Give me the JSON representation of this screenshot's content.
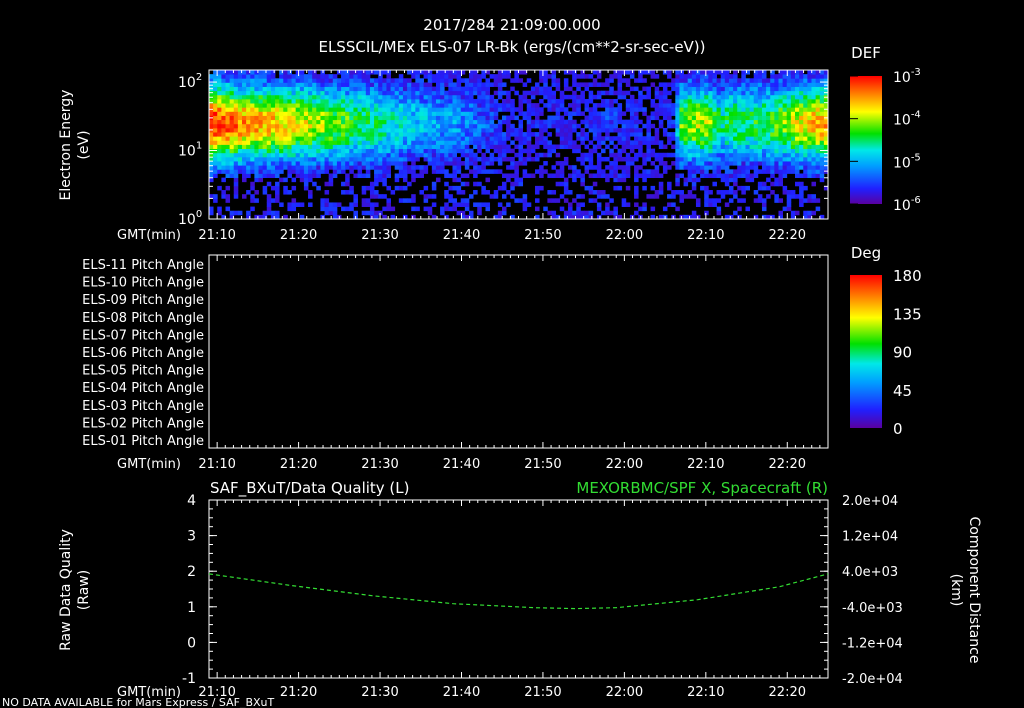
{
  "header": {
    "title": "2017/284 21:09:00.000",
    "subtitle": "ELSSCIL/MEx ELS-07 LR-Bk  (ergs/(cm**2-sr-sec-eV))"
  },
  "time_axis": {
    "label": "GMT(min)",
    "ticks": [
      "21:10",
      "21:20",
      "21:30",
      "21:40",
      "21:50",
      "22:00",
      "22:10",
      "22:20"
    ]
  },
  "footer_note": "NO DATA AVAILABLE for Mars  Express / SAF_BXuT",
  "chart_data": [
    {
      "type": "heatmap",
      "ylabel_line1": "Electron Energy",
      "ylabel_line2": "(eV)",
      "y_scale": "log",
      "ylim": [
        1,
        150
      ],
      "y_ticks": [
        {
          "base": "10",
          "exp": "0",
          "value": 1
        },
        {
          "base": "10",
          "exp": "1",
          "value": 10
        },
        {
          "base": "10",
          "exp": "2",
          "value": 100
        }
      ],
      "x_range_min": [
        0,
        76
      ],
      "time_ticks_min": [
        1,
        11,
        21,
        31,
        41,
        51,
        61,
        71
      ],
      "colorbar": {
        "title": "DEF",
        "scale": "log",
        "range": [
          1e-06,
          0.001
        ],
        "ticks": [
          {
            "base": "10",
            "exp": "-3",
            "value": 0.001
          },
          {
            "base": "10",
            "exp": "-4",
            "value": 0.0001
          },
          {
            "base": "10",
            "exp": "-5",
            "value": 1e-05
          },
          {
            "base": "10",
            "exp": "-6",
            "value": 1e-06
          }
        ]
      },
      "activity_by_time": [
        [
          0,
          1.0
        ],
        [
          4,
          0.85
        ],
        [
          10,
          0.75
        ],
        [
          18,
          0.55
        ],
        [
          24,
          0.4
        ],
        [
          28,
          0.3
        ],
        [
          30,
          0.3
        ],
        [
          33,
          0.22
        ],
        [
          36,
          0.12
        ],
        [
          40,
          0.08
        ],
        [
          48,
          0.08
        ],
        [
          49,
          0.15
        ],
        [
          52,
          0.08
        ],
        [
          57,
          0.1
        ],
        [
          58,
          0.6
        ],
        [
          61,
          0.7
        ],
        [
          63,
          0.45
        ],
        [
          64,
          0.55
        ],
        [
          66,
          0.5
        ],
        [
          70,
          0.6
        ],
        [
          73,
          0.75
        ],
        [
          76,
          0.85
        ]
      ],
      "peak_energy_ev": 25,
      "grid": false
    },
    {
      "type": "heatmap",
      "rows": [
        "ELS-11 Pitch Angle",
        "ELS-10 Pitch Angle",
        "ELS-09 Pitch Angle",
        "ELS-08 Pitch Angle",
        "ELS-07 Pitch Angle",
        "ELS-06 Pitch Angle",
        "ELS-05 Pitch Angle",
        "ELS-04 Pitch Angle",
        "ELS-03 Pitch Angle",
        "ELS-02 Pitch Angle",
        "ELS-01 Pitch Angle"
      ],
      "values": [],
      "colorbar": {
        "title": "Deg",
        "range": [
          0,
          180
        ],
        "ticks": [
          "180",
          "135",
          "90",
          "45",
          "0"
        ]
      }
    },
    {
      "type": "line",
      "title_left": "SAF_BXuT/Data Quality (L)",
      "title_right": "MEXORBMC/SPF X, Spacecraft (R)",
      "ylabel_left_line1": "Raw Data Quality",
      "ylabel_left_line2": "(Raw)",
      "ylabel_right_line1": "Component Distance",
      "ylabel_right_line2": "(km)",
      "ylim_left": [
        -1,
        4
      ],
      "y_ticks_left": [
        "4",
        "3",
        "2",
        "1",
        "0",
        "-1"
      ],
      "ylim_right": [
        -20000,
        20000
      ],
      "y_ticks_right": [
        "2.0e+04",
        "1.2e+04",
        "4.0e+03",
        "-4.0e+03",
        "-1.2e+04",
        "-2.0e+04"
      ],
      "series": [
        {
          "name": "MEXORBMC/SPF X, Spacecraft",
          "color": "#33dd33",
          "axis": "right",
          "x_min": [
            0,
            10,
            20,
            30,
            40,
            45,
            50,
            60,
            70,
            76
          ],
          "y_km": [
            3400,
            800,
            -1500,
            -3300,
            -4200,
            -4400,
            -4200,
            -2400,
            500,
            3400
          ]
        }
      ]
    }
  ]
}
